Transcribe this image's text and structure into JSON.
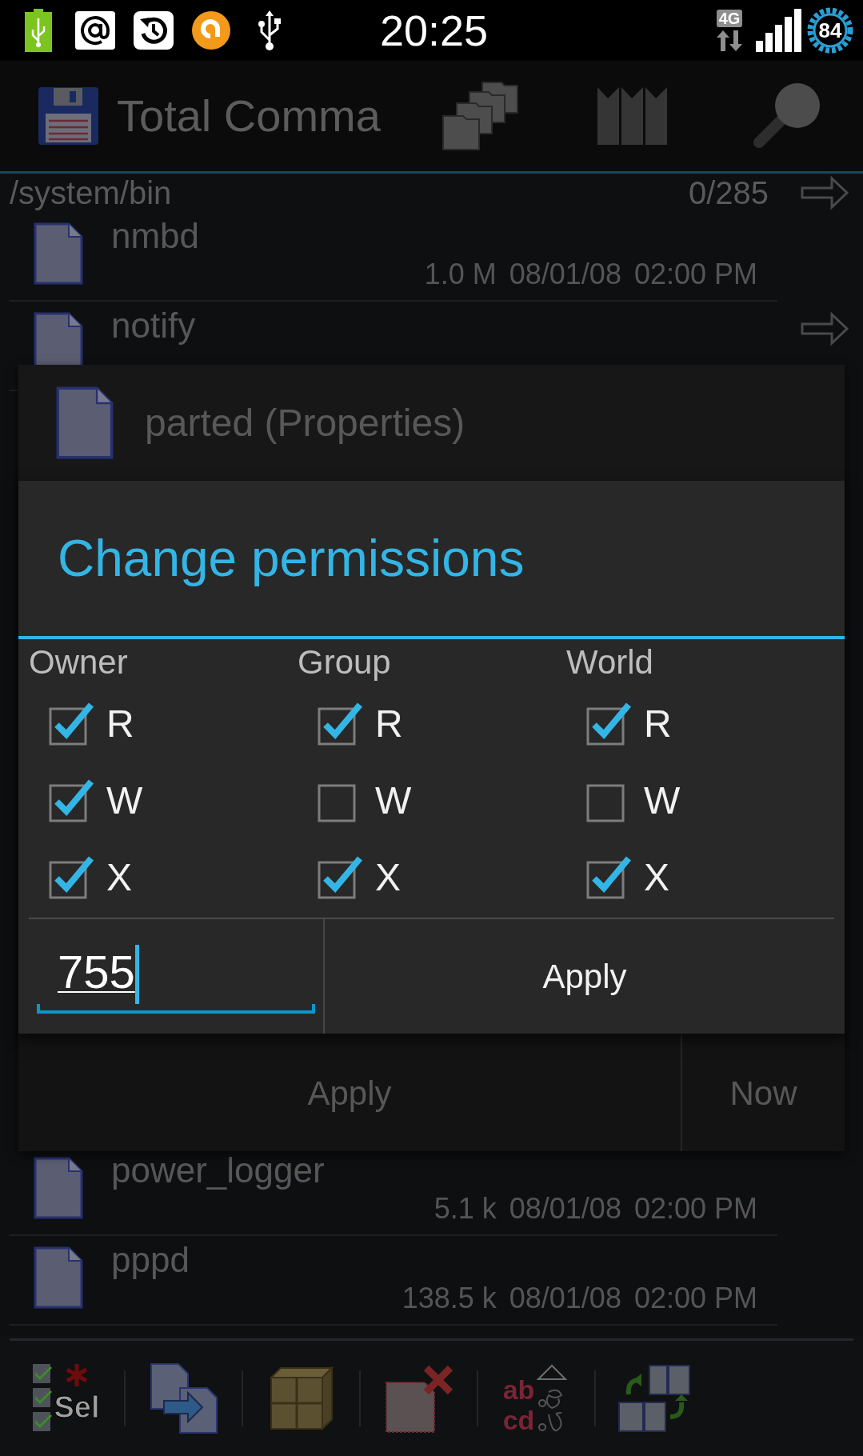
{
  "status_bar": {
    "time": "20:25",
    "network_type": "4G",
    "battery_percent": "84"
  },
  "action_bar": {
    "title": "Total Comma"
  },
  "path_bar": {
    "path": "/system/bin",
    "count": "0/285"
  },
  "files_above": [
    {
      "name": "nmbd",
      "size": "1.0 M",
      "date": "08/01/08",
      "time": "02:00 PM",
      "arrow": false
    },
    {
      "name": "notify",
      "arrow": true
    }
  ],
  "properties_dialog": {
    "title": "parted (Properties)",
    "buttons": [
      "Apply",
      "Now"
    ]
  },
  "permissions_dialog": {
    "title": "Change permissions",
    "groups": [
      {
        "label": "Owner",
        "flags": [
          {
            "letter": "R",
            "checked": true
          },
          {
            "letter": "W",
            "checked": true
          },
          {
            "letter": "X",
            "checked": true
          }
        ]
      },
      {
        "label": "Group",
        "flags": [
          {
            "letter": "R",
            "checked": true
          },
          {
            "letter": "W",
            "checked": false
          },
          {
            "letter": "X",
            "checked": true
          }
        ]
      },
      {
        "label": "World",
        "flags": [
          {
            "letter": "R",
            "checked": true
          },
          {
            "letter": "W",
            "checked": false
          },
          {
            "letter": "X",
            "checked": true
          }
        ]
      }
    ],
    "mode_value": "755",
    "apply_button": "Apply"
  },
  "files_below": [
    {
      "name": "power_logger",
      "size": "5.1 k",
      "date": "08/01/08",
      "time": "02:00 PM",
      "arrow": false
    },
    {
      "name": "pppd",
      "size": "138.5 k",
      "date": "08/01/08",
      "time": "02:00 PM",
      "arrow": false
    }
  ],
  "toolbar": [
    {
      "kind": "select",
      "label": "Sel"
    },
    {
      "kind": "copy"
    },
    {
      "kind": "pack"
    },
    {
      "kind": "delete"
    },
    {
      "kind": "sort",
      "lines": [
        "ab",
        "cd"
      ]
    },
    {
      "kind": "swap"
    }
  ]
}
